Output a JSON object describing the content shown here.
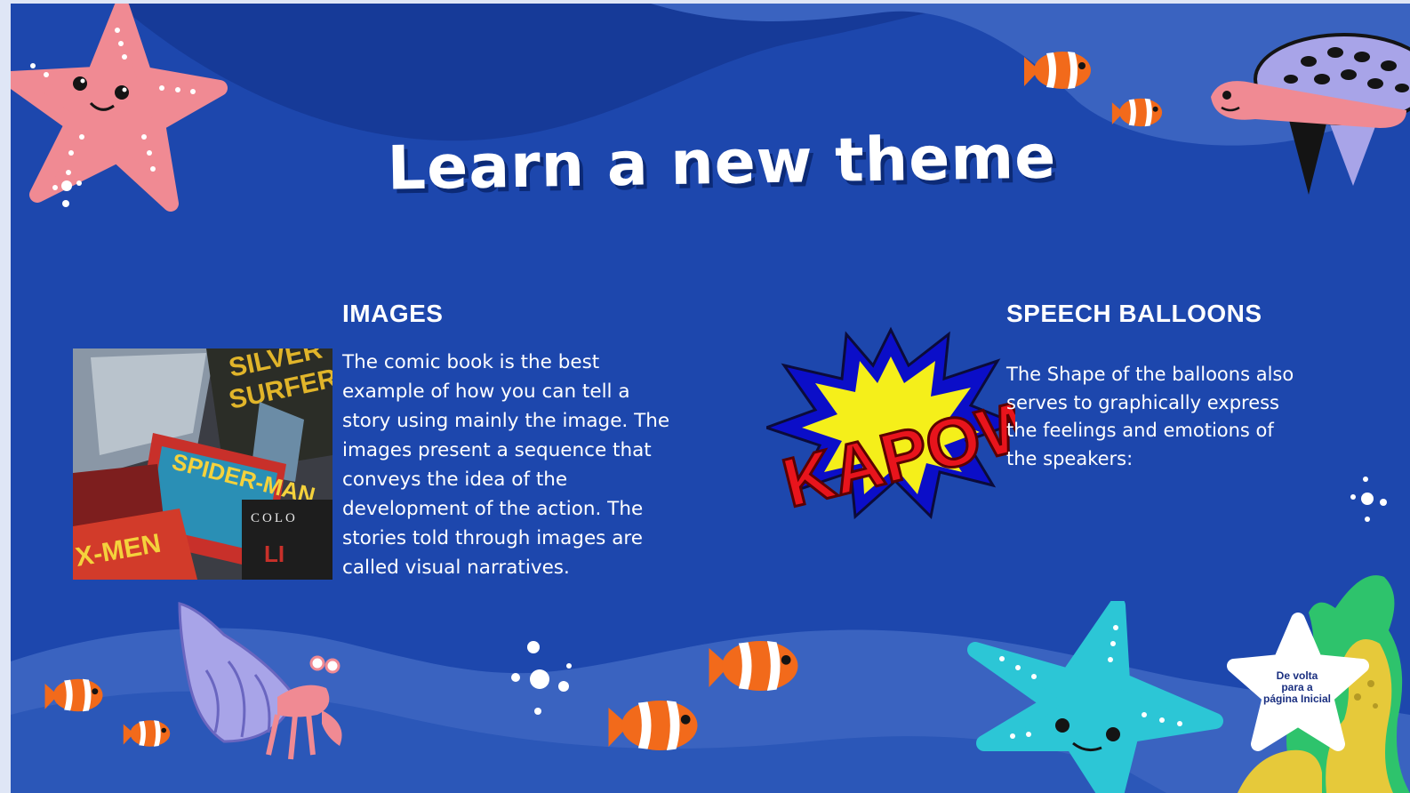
{
  "slide": {
    "title": "Learn a new theme",
    "background_color": "#1d47ad",
    "wave_color_dark": "#163a98",
    "wave_color_light": "#3a63c0"
  },
  "images_section": {
    "heading": "IMAGES",
    "text": "The comic book is the best example of how you can tell a story using mainly the image. The images present a sequence that conveys the idea of the development of the action. The stories told through images are called visual narratives.",
    "lines": [
      "The comic book is the best",
      "example of how you can tell a",
      "story using mainly the image. The",
      "images present a sequence that",
      "conveys the idea of the",
      "development of the action. The",
      "stories told through images are",
      "called visual narratives."
    ],
    "photo": {
      "icon": "comic-books-photo",
      "cover_texts": [
        "SILVER SURFER",
        "SPIDER-MAN",
        "COLO",
        "X-MEN"
      ]
    }
  },
  "speech_section": {
    "heading": "SPEECH BALLOONS",
    "lines": [
      "The Shape of the balloons also",
      "serves to graphically express",
      "the feelings and emotions of",
      "the speakers:"
    ],
    "kapow_text": "KAPOW!"
  },
  "home_button": {
    "lines": [
      "De volta",
      "para a",
      "página Inicial"
    ],
    "icon": "star-icon"
  },
  "colors": {
    "starfish_pink": "#f08a93",
    "starfish_cyan": "#2cc6d6",
    "clownfish_orange": "#f26a1b",
    "turtle_purple": "#a8a4e8",
    "seaweed_green": "#2ec36c",
    "seaweed_yellow": "#e6c93a"
  }
}
